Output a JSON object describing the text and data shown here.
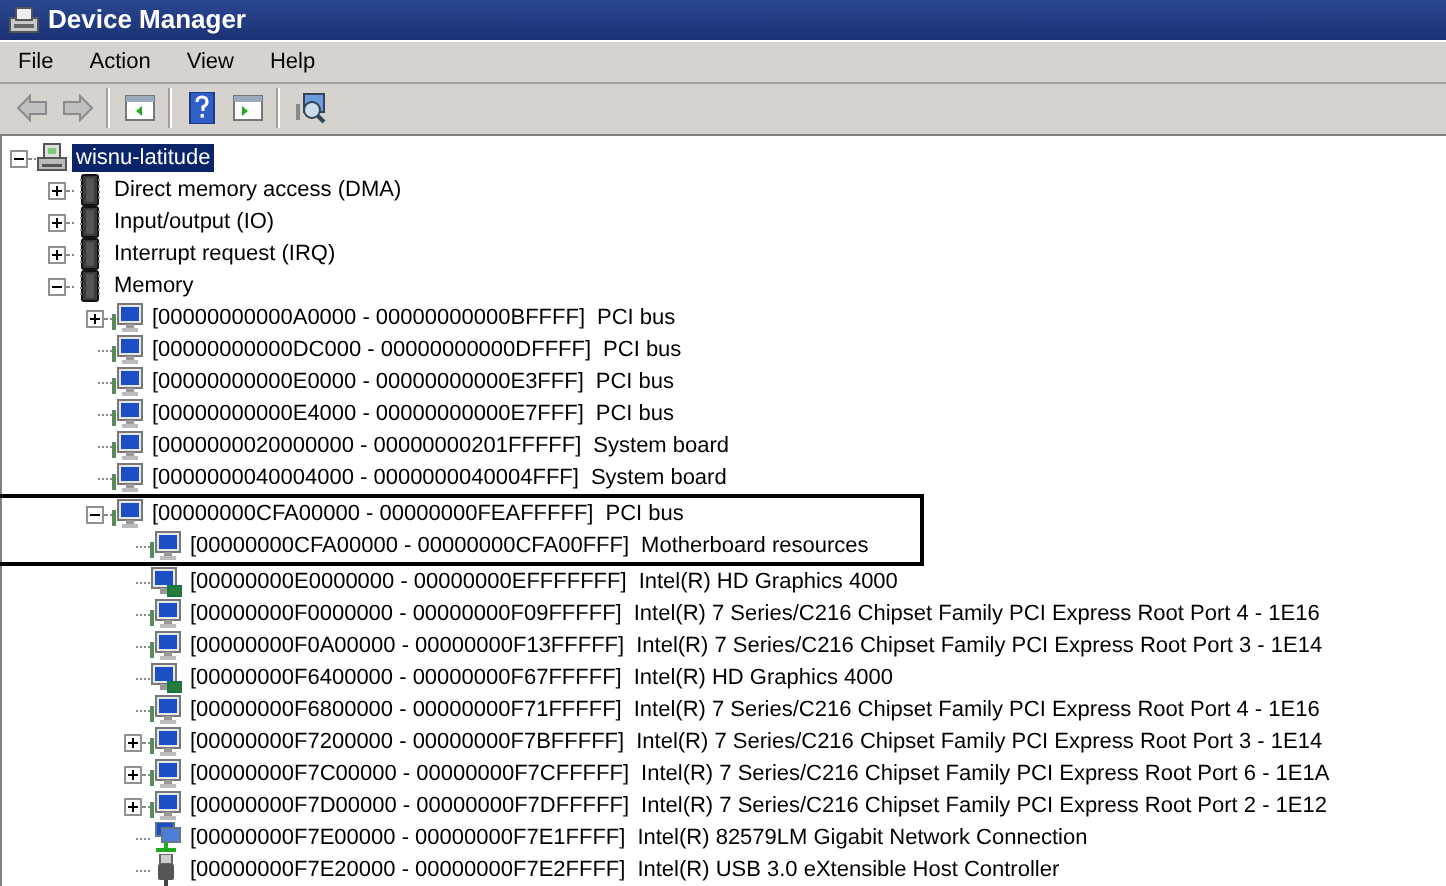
{
  "window": {
    "title": "Device Manager"
  },
  "menu": [
    "File",
    "Action",
    "View",
    "Help"
  ],
  "toolbar": [
    {
      "kind": "back",
      "disabled": true
    },
    {
      "kind": "forward",
      "disabled": true
    },
    {
      "kind": "separator"
    },
    {
      "kind": "console-tree",
      "disabled": false
    },
    {
      "kind": "separator"
    },
    {
      "kind": "help",
      "disabled": false
    },
    {
      "kind": "action-pane",
      "disabled": false
    },
    {
      "kind": "separator"
    },
    {
      "kind": "scan",
      "disabled": false
    }
  ],
  "tree": [
    {
      "label": "wisnu-latitude",
      "kind": "computer",
      "selected": true,
      "expanded": true,
      "children": [
        {
          "label": "Direct memory access (DMA)",
          "kind": "chip",
          "selected": false,
          "expanded": false
        },
        {
          "label": "Input/output (IO)",
          "kind": "chip",
          "selected": false,
          "expanded": false
        },
        {
          "label": "Interrupt request (IRQ)",
          "kind": "chip",
          "selected": false,
          "expanded": false
        },
        {
          "label": "Memory",
          "kind": "chip",
          "selected": false,
          "expanded": true,
          "children": [
            {
              "range": "[00000000000A0000 - 00000000000BFFFF]",
              "label": "PCI bus",
              "kind": "pci",
              "selected": false,
              "expanded": false
            },
            {
              "range": "[00000000000DC000 - 00000000000DFFFF]",
              "label": "PCI bus",
              "kind": "pci",
              "selected": false
            },
            {
              "range": "[00000000000E0000 - 00000000000E3FFF]",
              "label": "PCI bus",
              "kind": "pci",
              "selected": false
            },
            {
              "range": "[00000000000E4000 - 00000000000E7FFF]",
              "label": "PCI bus",
              "kind": "pci",
              "selected": false
            },
            {
              "range": "[0000000020000000 - 00000000201FFFFF]",
              "label": "System board",
              "kind": "pci",
              "selected": false
            },
            {
              "range": "[0000000040004000 - 0000000040004FFF]",
              "label": "System board",
              "kind": "pci",
              "selected": false
            },
            {
              "range": "[00000000CFA00000 - 00000000FEAFFFFF]",
              "label": "PCI bus",
              "kind": "pci",
              "selected": false,
              "expanded": true,
              "outlined": true,
              "children": [
                {
                  "range": "[00000000CFA00000 - 00000000CFA00FFF]",
                  "label": "Motherboard resources",
                  "kind": "pci",
                  "selected": false
                },
                {
                  "range": "[00000000E0000000 - 00000000EFFFFFFF]",
                  "label": "Intel(R) HD Graphics 4000",
                  "kind": "display",
                  "selected": false
                },
                {
                  "range": "[00000000F0000000 - 00000000F09FFFFF]",
                  "label": "Intel(R) 7 Series/C216 Chipset Family PCI Express Root Port 4 - 1E16",
                  "kind": "pci",
                  "selected": false
                },
                {
                  "range": "[00000000F0A00000 - 00000000F13FFFFF]",
                  "label": "Intel(R) 7 Series/C216 Chipset Family PCI Express Root Port 3 - 1E14",
                  "kind": "pci",
                  "selected": false
                },
                {
                  "range": "[00000000F6400000 - 00000000F67FFFFF]",
                  "label": "Intel(R) HD Graphics 4000",
                  "kind": "display",
                  "selected": false
                },
                {
                  "range": "[00000000F6800000 - 00000000F71FFFFF]",
                  "label": "Intel(R) 7 Series/C216 Chipset Family PCI Express Root Port 4 - 1E16",
                  "kind": "pci",
                  "selected": false
                },
                {
                  "range": "[00000000F7200000 - 00000000F7BFFFFF]",
                  "label": "Intel(R) 7 Series/C216 Chipset Family PCI Express Root Port 3 - 1E14",
                  "kind": "pci",
                  "selected": false,
                  "expanded": false
                },
                {
                  "range": "[00000000F7C00000 - 00000000F7CFFFFF]",
                  "label": "Intel(R) 7 Series/C216 Chipset Family PCI Express Root Port 6 - 1E1A",
                  "kind": "pci",
                  "selected": false,
                  "expanded": false
                },
                {
                  "range": "[00000000F7D00000 - 00000000F7DFFFFF]",
                  "label": "Intel(R) 7 Series/C216 Chipset Family PCI Express Root Port 2 - 1E12",
                  "kind": "pci",
                  "selected": false,
                  "expanded": false
                },
                {
                  "range": "[00000000F7E00000 - 00000000F7E1FFFF]",
                  "label": "Intel(R) 82579LM Gigabit Network Connection",
                  "kind": "network",
                  "selected": false
                },
                {
                  "range": "[00000000F7E20000 - 00000000F7E2FFFF]",
                  "label": "Intel(R) USB 3.0 eXtensible Host Controller",
                  "kind": "usb",
                  "selected": false
                }
              ]
            }
          ]
        }
      ]
    }
  ]
}
